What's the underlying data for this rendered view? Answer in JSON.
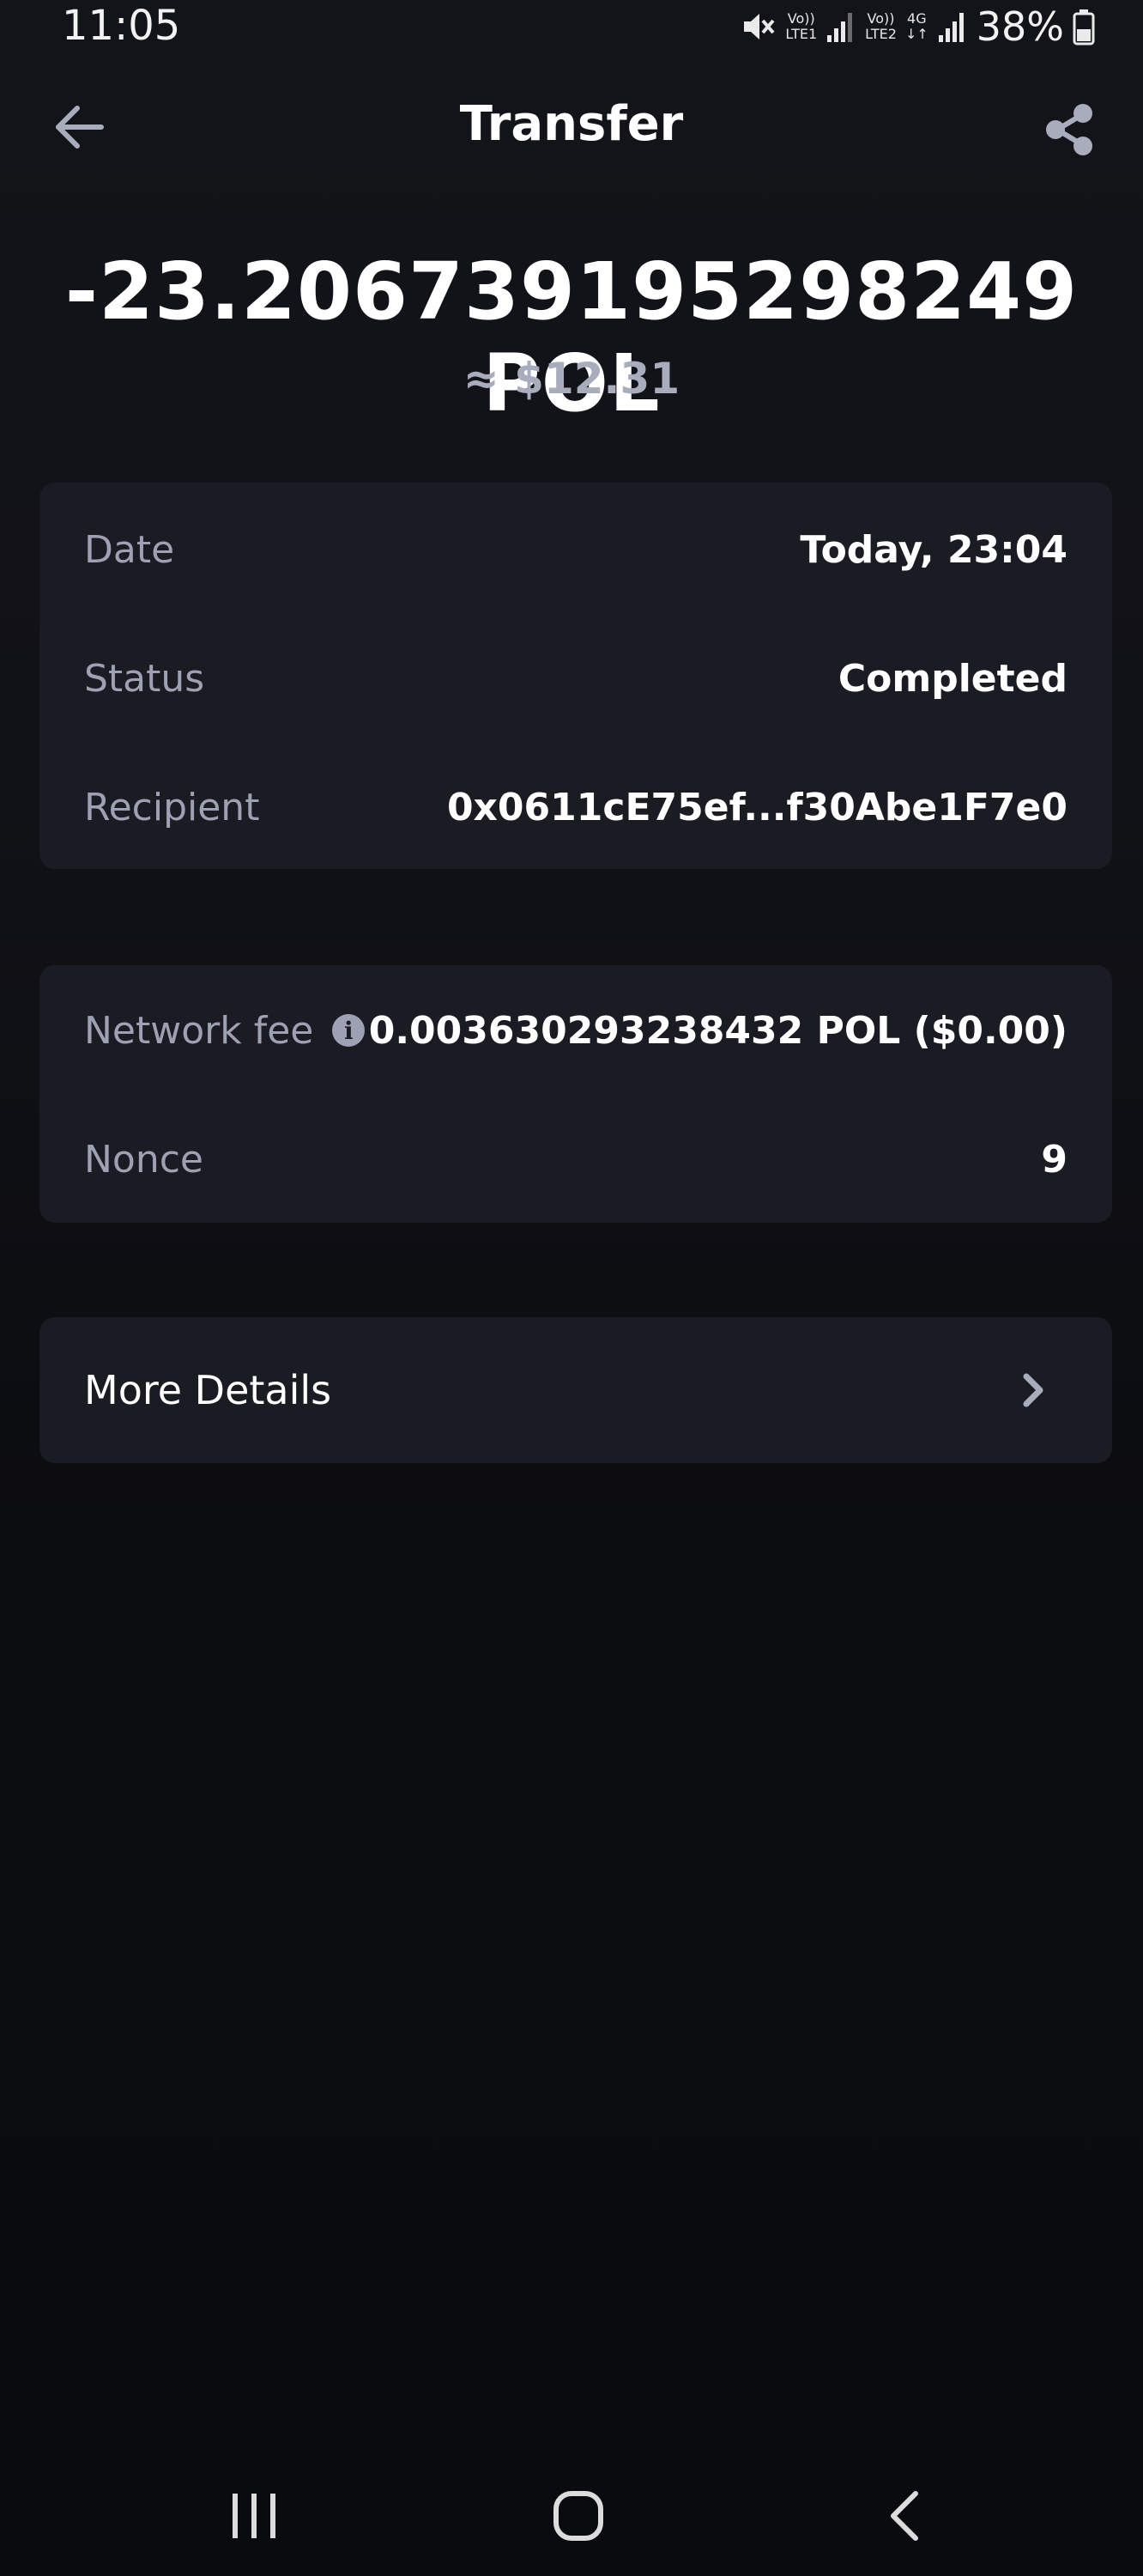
{
  "status_bar": {
    "time": "11:05",
    "sim1_top": "Vo))",
    "sim1_bottom": "LTE1",
    "sim2_top": "Vo))",
    "sim2_bottom": "LTE2",
    "network_type": "4G",
    "battery": "38%"
  },
  "header": {
    "title": "Transfer"
  },
  "transaction": {
    "amount": "-23.206739195298249 POL",
    "fiat_value": "≈ $12.31"
  },
  "details": {
    "date_label": "Date",
    "date_value": "Today, 23:04",
    "status_label": "Status",
    "status_value": "Completed",
    "recipient_label": "Recipient",
    "recipient_value": "0x0611cE75ef...f30Abe1F7e0"
  },
  "fees": {
    "network_fee_label": "Network fee",
    "network_fee_value": "0.003630293238432 POL ($0.00)",
    "nonce_label": "Nonce",
    "nonce_value": "9"
  },
  "more_details": {
    "label": "More Details"
  },
  "icons": {
    "back": "arrow-left-icon",
    "share": "share-icon",
    "info": "info-icon",
    "chevron": "chevron-right-icon",
    "recents": "recents-icon",
    "home": "home-icon",
    "nav_back": "nav-back-icon"
  },
  "colors": {
    "background": "#111217",
    "card": "#1b1c23",
    "label": "#9ea1b3",
    "value": "#ffffff"
  }
}
